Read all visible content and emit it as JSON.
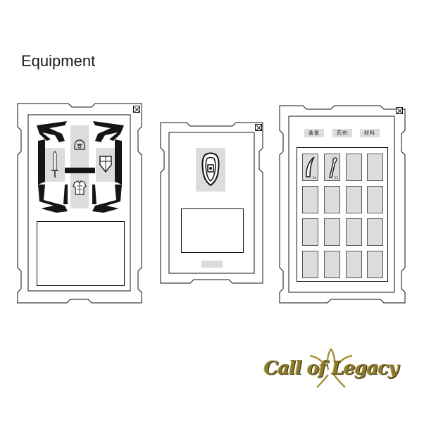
{
  "header": {
    "title": "Equipment"
  },
  "windows": {
    "equipment": {
      "close_icon": "close-icon"
    },
    "item_detail": {
      "close_icon": "close-icon"
    },
    "inventory": {
      "tabs": [
        {
          "label": "装备"
        },
        {
          "label": "药剂"
        },
        {
          "label": "材料"
        }
      ],
      "grid": {
        "rows": 4,
        "cols": 4
      },
      "items": [
        {
          "name": "horn-icon",
          "qty": "04"
        },
        {
          "name": "bone-icon",
          "qty": "23"
        }
      ]
    }
  },
  "logo": {
    "text": "Call of Legacy"
  },
  "colors": {
    "slot": "#dcdcdc",
    "line": "#111111",
    "logo_gold": "#8a7a2e"
  }
}
